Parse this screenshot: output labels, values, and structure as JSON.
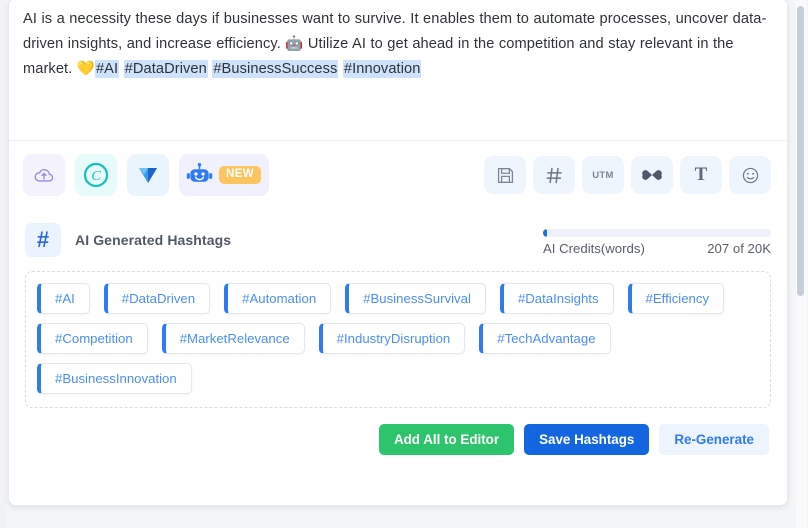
{
  "composer": {
    "text_part_1": "AI is a necessity these days if businesses want to survive. It enables them to automate processes, uncover data-driven insights, and increase efficiency. ",
    "emoji_robot": "🤖",
    "text_part_2": " Utilize AI to get ahead in the competition and stay relevant in the market. ",
    "emoji_heart": "💛",
    "hashtags_inline": [
      "#AI",
      "#DataDriven",
      "#BusinessSuccess",
      "#Innovation"
    ]
  },
  "toolbar": {
    "left_items": [
      {
        "name": "cloud-upload-icon",
        "label": "Upload"
      },
      {
        "name": "canva-icon",
        "label": "Canva"
      },
      {
        "name": "vistacreate-icon",
        "label": "VistaCreate"
      },
      {
        "name": "ai-robot-icon",
        "label": "AI Assistant",
        "badge": "NEW"
      }
    ],
    "right_items": [
      {
        "name": "save-icon",
        "label": "Save"
      },
      {
        "name": "hashtag-icon",
        "label": "Hashtags"
      },
      {
        "name": "utm-icon",
        "label": "UTM"
      },
      {
        "name": "link-icon",
        "label": "Shorten Link"
      },
      {
        "name": "text-format-icon",
        "label": "T"
      },
      {
        "name": "emoji-icon",
        "label": "Emoji"
      }
    ],
    "utm_label": "UTM",
    "text_label": "T"
  },
  "panel": {
    "hash_symbol": "#",
    "title": "AI Generated Hashtags",
    "credits": {
      "label": "AI Credits(words)",
      "value": "207 of 20K",
      "used": 207,
      "total": 20000,
      "percent": 1.04
    },
    "hashtags": [
      "#AI",
      "#DataDriven",
      "#Automation",
      "#BusinessSurvival",
      "#DataInsights",
      "#Efficiency",
      "#Competition",
      "#MarketRelevance",
      "#IndustryDisruption",
      "#TechAdvantage",
      "#BusinessInnovation"
    ],
    "actions": {
      "add_all": "Add All to Editor",
      "save": "Save Hashtags",
      "regenerate": "Re-Generate"
    }
  },
  "colors": {
    "accent_blue": "#2f7cf0",
    "save_blue": "#1366e0",
    "add_green": "#2ec46d",
    "badge_orange": "#fbc55f",
    "highlight": "#cfe2fb"
  }
}
